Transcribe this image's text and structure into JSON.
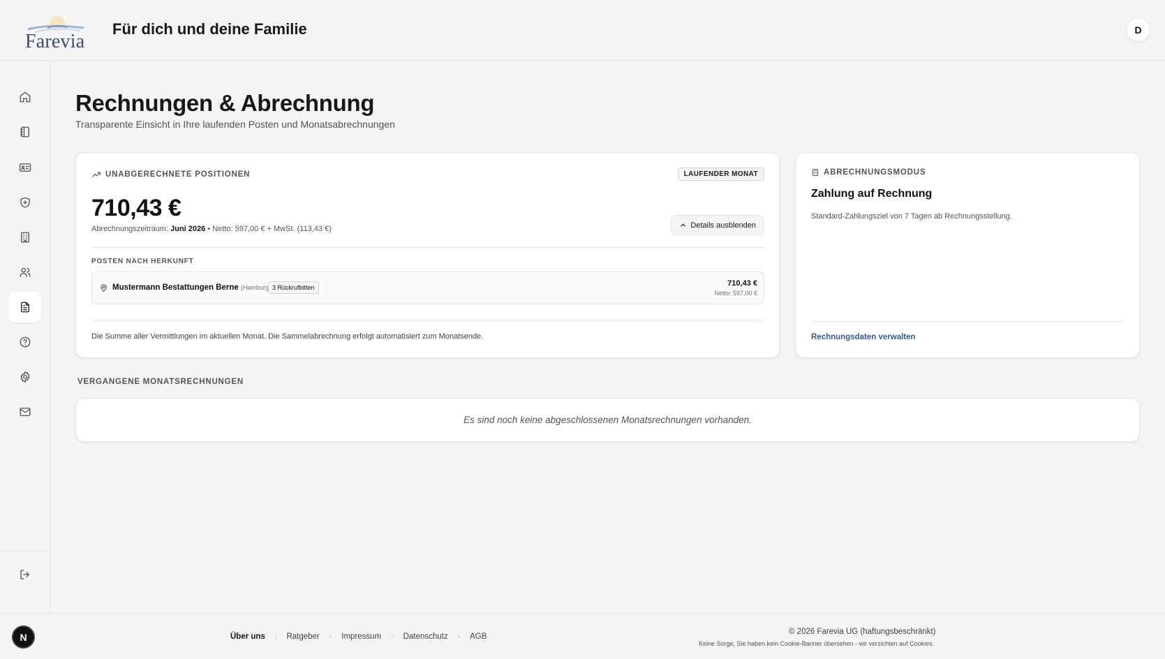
{
  "header": {
    "logo_text": "Farevia",
    "title": "Für dich und deine Familie",
    "avatar_initial": "D"
  },
  "sidebar": {
    "items": [
      {
        "icon": "home-icon"
      },
      {
        "icon": "notebook-icon"
      },
      {
        "icon": "id-card-icon"
      },
      {
        "icon": "shield-plus-icon"
      },
      {
        "icon": "building-icon"
      },
      {
        "icon": "users-icon"
      },
      {
        "icon": "file-text-icon",
        "active": true
      },
      {
        "icon": "help-circle-icon"
      },
      {
        "icon": "gear-icon"
      },
      {
        "icon": "mail-icon"
      }
    ],
    "logout_icon": "logout-icon"
  },
  "page": {
    "title": "Rechnungen & Abrechnung",
    "subtitle": "Transparente Einsicht in Ihre laufenden Posten und Monatsabrechnungen"
  },
  "current": {
    "label": "Unabgerechnete Positionen",
    "badge": "LAUFENDER MONAT",
    "amount": "710,43 €",
    "period_prefix": "Abrechnungszeitraum: ",
    "period_month": "Juni 2026",
    "period_suffix": " • Netto: 597,00 € + MwSt. (113,43 €)",
    "toggle_label": "Details ausblenden",
    "breakdown_label": "Posten nach Herkunft",
    "posten": {
      "name": "Mustermann Bestattungen Berne",
      "city": "(Hamburg)",
      "tag": "3 Rückrufbitten",
      "amount": "710,43 €",
      "netto": "Netto: 597,00 €"
    },
    "note": "Die Summe aller Vermittlungen im aktuellen Monat. Die Sammelabrechnung erfolgt automatisiert zum Monatsende."
  },
  "billing_mode": {
    "label": "Abrechnungsmodus",
    "title": "Zahlung auf Rechnung",
    "text": "Standard-Zahlungsziel von 7 Tagen ab Rechnungsstellung.",
    "link": "Rechnungsdaten verwalten"
  },
  "past": {
    "label": "Vergangene Monatsrechnungen",
    "empty": "Es sind noch keine abgeschlossenen Monatsrechnungen vorhanden."
  },
  "footer": {
    "badge": "N",
    "links": [
      "Über uns",
      "Ratgeber",
      "Impressum",
      "Datenschutz",
      "AGB"
    ],
    "copyright": "© 2026 Farevia UG (haftungsbeschränkt)",
    "cookie_note": "Keine Sorge, Sie haben kein Cookie-Banner übersehen - wir verzichten auf Cookies."
  },
  "colors": {
    "accent_link": "#3a5a8c",
    "background": "#f4f4f5"
  }
}
